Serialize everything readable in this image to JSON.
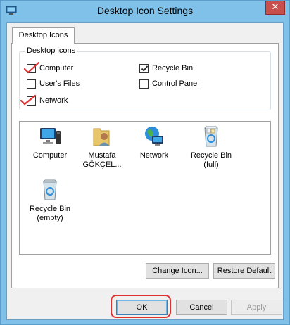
{
  "window": {
    "title": "Desktop Icon Settings",
    "close_glyph": "✕"
  },
  "tabs": [
    {
      "label": "Desktop Icons",
      "selected": true
    }
  ],
  "desktop_icons_group": {
    "legend": "Desktop icons",
    "checkboxes": [
      {
        "label": "Computer",
        "checked": false,
        "annotated": true
      },
      {
        "label": "Recycle Bin",
        "checked": true,
        "annotated": false
      },
      {
        "label": "User's Files",
        "checked": false,
        "annotated": false
      },
      {
        "label": "Control Panel",
        "checked": false,
        "annotated": false
      },
      {
        "label": "Network",
        "checked": false,
        "annotated": true
      }
    ]
  },
  "icon_list": [
    {
      "line1": "Computer",
      "line2": "",
      "icon": "computer-icon"
    },
    {
      "line1": "Mustafa",
      "line2": "GÖKÇEL...",
      "icon": "user-folder-icon"
    },
    {
      "line1": "Network",
      "line2": "",
      "icon": "network-icon"
    },
    {
      "line1": "Recycle Bin",
      "line2": "(full)",
      "icon": "recycle-bin-full-icon"
    },
    {
      "line1": "Recycle Bin",
      "line2": "(empty)",
      "icon": "recycle-bin-empty-icon"
    }
  ],
  "buttons": {
    "change_icon": "Change Icon...",
    "restore_default": "Restore Default",
    "ok": "OK",
    "cancel": "Cancel",
    "apply": "Apply"
  },
  "colors": {
    "title_bar": "#7fc1e8",
    "close_button": "#c7504c",
    "annotation_red": "#e03030"
  }
}
